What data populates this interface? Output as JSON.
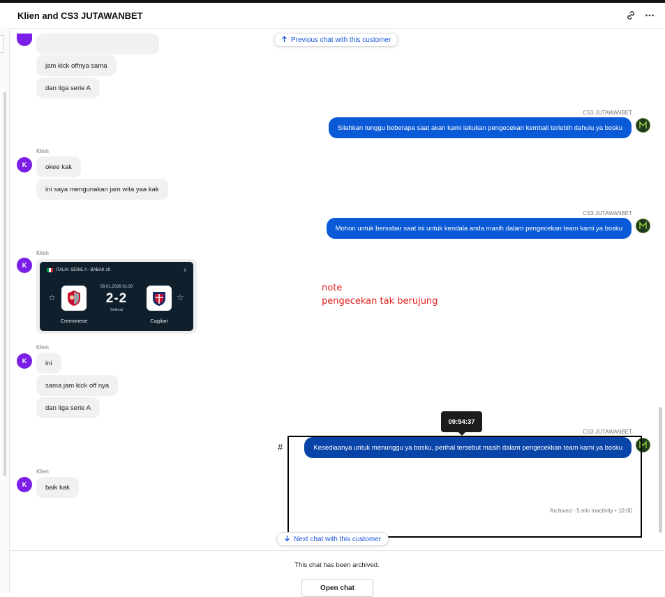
{
  "header": {
    "title": "Klien and CS3 JUTAWANBET",
    "link_icon": "link-icon",
    "more_icon": "more-horizontal-icon"
  },
  "nav": {
    "previous_label": "Previous chat with this customer",
    "next_label": "Next chat with this customer",
    "arrow_up_icon": "arrow-up-icon",
    "arrow_down_icon": "arrow-down-icon"
  },
  "customer": {
    "name": "Klien",
    "initial": "K"
  },
  "agent": {
    "name": "CS3 JUTAWANBET"
  },
  "messages": {
    "c1_m1": "jam kick offnya sama",
    "c1_m2": "dan liga serie A",
    "a1": "Silahkan tunggu beberapa saat akan kami lakukan pengecekan kembali terlebih dahulu ya bosku",
    "c2_m1": "okee kak",
    "c2_m2": "ini saya mengunakan jam wita yaa kak",
    "a2": "Mohon untuk bersabar saat ini untuk kendala anda masih dalam pengecekan team kami ya bosku",
    "c4_m1": "ini",
    "c4_m2": "sama jam kick off nya",
    "c4_m3": "dan liga serie A",
    "a3": "Kesediaanya untuk menunggu ya bosku, perihal tersebut masih dalam pengecekkan team kami ya bosku",
    "c5_m1": "baik kak"
  },
  "match_card": {
    "league": "ITALIA: SERIE A - BABAK 19",
    "date": "09.01.2026 01:30",
    "score": "2-2",
    "status": "Selesai",
    "home_team": "Cremonese",
    "away_team": "Cagliari",
    "flag_colors": [
      "#009246",
      "#ffffff",
      "#ce2b37"
    ]
  },
  "note": {
    "line1": "note",
    "line2": "pengecekan tak berujung",
    "color": "#e0201e"
  },
  "tooltip": {
    "time": "09:54:37"
  },
  "hash_mark": "#",
  "archived_meta": "Archived - 5 min inactivity • 10:00",
  "footer": {
    "archived_text": "This chat has been archived.",
    "open_chat_label": "Open chat"
  },
  "colors": {
    "agent_bubble": "#0a5ad7",
    "agent_bubble_selected": "#0944a8",
    "customer_bubble": "#f1f1f1",
    "customer_avatar": "#7b1fe8",
    "link_blue": "#1a55d6"
  }
}
